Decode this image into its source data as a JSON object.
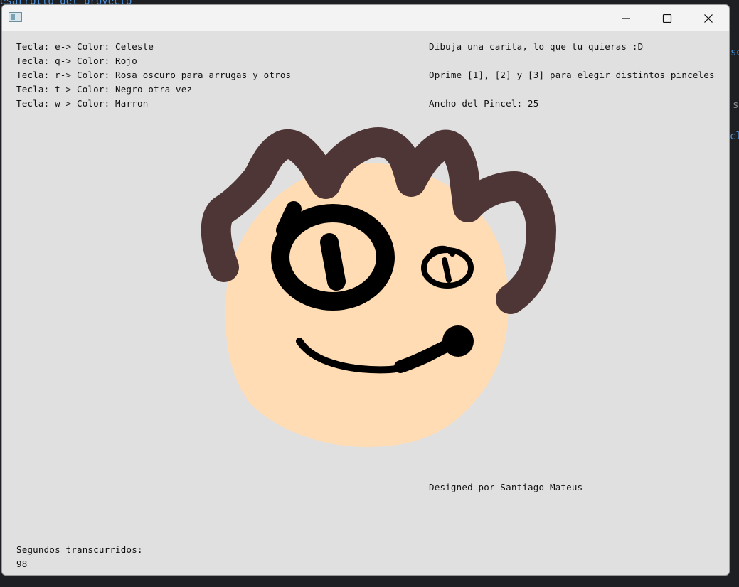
{
  "background_editor": {
    "top_line": "esarrollo del proyecto",
    "right_fragments": [
      "so",
      "s",
      "cl"
    ]
  },
  "window": {
    "title": "",
    "controls": {
      "minimize": "─",
      "maximize": "☐",
      "close": "✕"
    }
  },
  "instructions_left": [
    "Tecla: e-> Color: Celeste",
    "Tecla: q-> Color: Rojo",
    "Tecla: r-> Color: Rosa oscuro para arrugas y otros",
    "Tecla: t-> Color: Negro otra vez",
    "Tecla: w-> Color: Marron"
  ],
  "instructions_right": {
    "prompt": "Dibuja una carita, lo que tu quieras :D",
    "brushes": "Oprime [1], [2] y [3] para elegir distintos pinceles",
    "brush_width_label": "Ancho del Pincel: 25"
  },
  "credits": "Designed por Santiago Mateus",
  "timer": {
    "label": "Segundos transcurridos:",
    "value": "98"
  },
  "colors": {
    "canvas": "#e0e0e0",
    "skin": "#ffdcb4",
    "hair": "#4f3636",
    "ink": "#000000"
  }
}
